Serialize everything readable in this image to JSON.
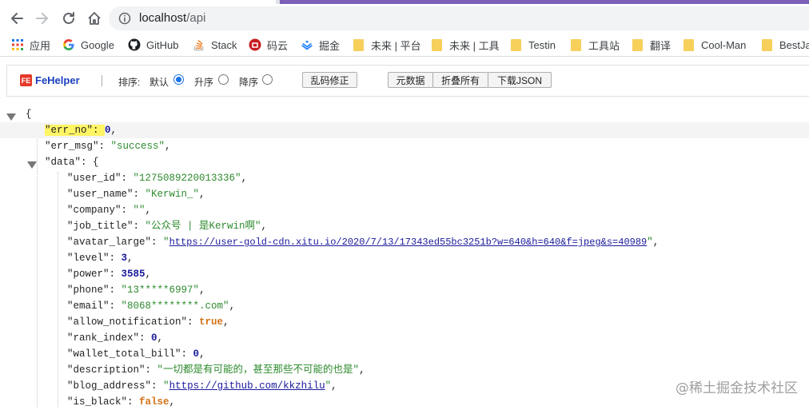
{
  "browser": {
    "url_host": "localhost",
    "url_path": "/api"
  },
  "bookmarks": {
    "apps": "应用",
    "google": "Google",
    "github": "GitHub",
    "stack": "Stack",
    "maoyun": "码云",
    "juejin": "掘金",
    "future_platform": "未来 | 平台",
    "future_tools": "未来 | 工具",
    "testin": "Testin",
    "tools": "工具站",
    "translate": "翻译",
    "coolman": "Cool-Man",
    "bestjava": "BestJav"
  },
  "fehelper": {
    "name": "FeHelper",
    "badge": "FE",
    "sort_label": "排序:",
    "sort_default": "默认",
    "sort_asc": "升序",
    "sort_desc": "降序",
    "fix_encoding": "乱码修正",
    "raw_data": "元数据",
    "collapse_all": "折叠所有",
    "download_json": "下载JSON"
  },
  "json": {
    "open_brace": "{",
    "fields": [
      {
        "key": "\"err_no\"",
        "value": "0",
        "type": "number"
      },
      {
        "key": "\"err_msg\"",
        "value": "\"success\"",
        "type": "string"
      },
      {
        "key": "\"data\"",
        "value": "{",
        "type": "object"
      }
    ],
    "data_fields": [
      {
        "key": "\"user_id\"",
        "value": "\"1275089220013336\"",
        "type": "string"
      },
      {
        "key": "\"user_name\"",
        "value": "\"Kerwin_\"",
        "type": "string"
      },
      {
        "key": "\"company\"",
        "value": "\"\"",
        "type": "string"
      },
      {
        "key": "\"job_title\"",
        "value": "\"公众号 | 是Kerwin啊\"",
        "type": "string"
      },
      {
        "key": "\"avatar_large\"",
        "value": "https://user-gold-cdn.xitu.io/2020/7/13/17343ed55bc3251b?w=640&h=640&f=jpeg&s=40989",
        "type": "url"
      },
      {
        "key": "\"level\"",
        "value": "3",
        "type": "number"
      },
      {
        "key": "\"power\"",
        "value": "3585",
        "type": "number"
      },
      {
        "key": "\"phone\"",
        "value": "\"13*****6997\"",
        "type": "string"
      },
      {
        "key": "\"email\"",
        "value": "\"8068********.com\"",
        "type": "string"
      },
      {
        "key": "\"allow_notification\"",
        "value": "true",
        "type": "bool"
      },
      {
        "key": "\"rank_index\"",
        "value": "0",
        "type": "number"
      },
      {
        "key": "\"wallet_total_bill\"",
        "value": "0",
        "type": "number"
      },
      {
        "key": "\"description\"",
        "value": "\"一切都是有可能的，甚至那些不可能的也是\"",
        "type": "string"
      },
      {
        "key": "\"blog_address\"",
        "value": "https://github.com/kkzhilu",
        "type": "url"
      },
      {
        "key": "\"is_black\"",
        "value": "false",
        "type": "bool"
      }
    ]
  },
  "watermark": "@稀土掘金技术社区"
}
